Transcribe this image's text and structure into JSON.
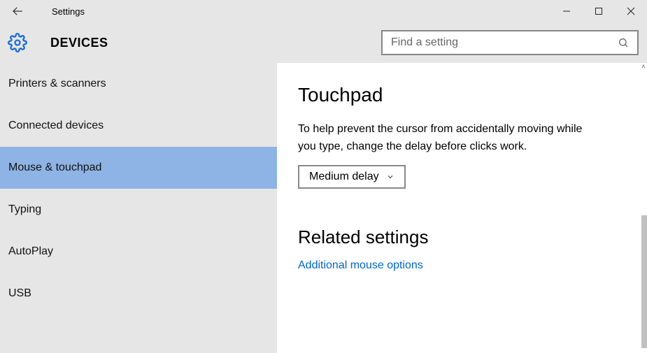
{
  "window": {
    "title": "Settings"
  },
  "header": {
    "category": "DEVICES"
  },
  "search": {
    "placeholder": "Find a setting",
    "value": ""
  },
  "sidebar": {
    "items": [
      {
        "label": "Printers & scanners",
        "selected": false
      },
      {
        "label": "Connected devices",
        "selected": false
      },
      {
        "label": "Mouse & touchpad",
        "selected": true
      },
      {
        "label": "Typing",
        "selected": false
      },
      {
        "label": "AutoPlay",
        "selected": false
      },
      {
        "label": "USB",
        "selected": false
      }
    ]
  },
  "main": {
    "section_title": "Touchpad",
    "description": "To help prevent the cursor from accidentally moving while you type, change the delay before clicks work.",
    "dropdown_value": "Medium delay",
    "related_title": "Related settings",
    "related_link": "Additional mouse options"
  }
}
